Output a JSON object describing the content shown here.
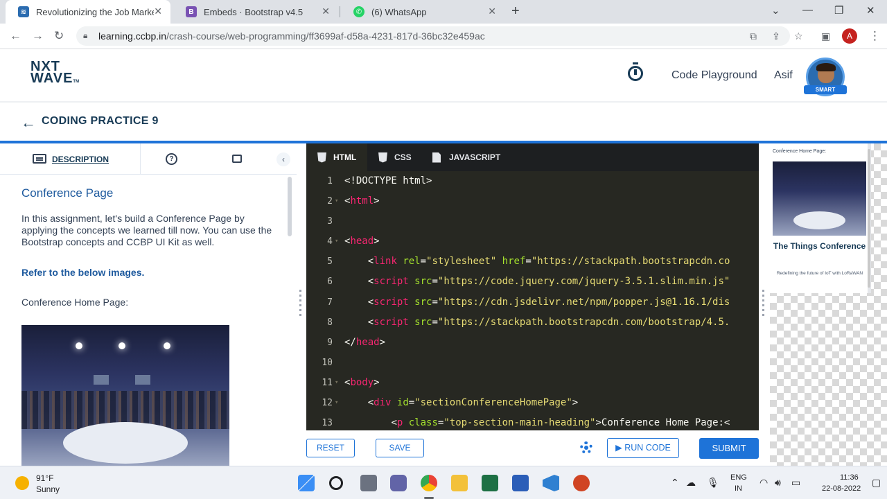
{
  "browser": {
    "tabs": [
      {
        "title": "Revolutionizing the Job Market |",
        "favicon": "nxtwave-icon"
      },
      {
        "title": "Embeds · Bootstrap v4.5",
        "favicon": "bootstrap-icon"
      },
      {
        "title": "(6) WhatsApp",
        "favicon": "whatsapp-icon"
      }
    ],
    "url_domain": "learning.ccbp.in",
    "url_path": "/crash-course/web-programming/ff3699af-d58a-4231-817d-36bc32e459ac",
    "profile_initial": "A"
  },
  "site": {
    "logo_line1": "NXT",
    "logo_line2": "WAVE",
    "logo_tm": "TM",
    "playground_label": "Code Playground",
    "username": "Asif",
    "avatar_badge": "SMART"
  },
  "practice": {
    "title": "CODING PRACTICE 9"
  },
  "description": {
    "tab_label": "DESCRIPTION",
    "help_glyph": "?",
    "collapse_glyph": "‹",
    "heading": "Conference Page",
    "intro": "In this assignment, let's build a Conference Page by applying the concepts we learned till now. You can use the Bootstrap concepts and CCBP UI Kit as well.",
    "refer": "Refer to the below images.",
    "home_label": "Conference Home Page:"
  },
  "editor": {
    "tabs": [
      "HTML",
      "CSS",
      "JAVASCRIPT"
    ],
    "lines": [
      {
        "n": "1",
        "fold": "",
        "html": "<span class='p'>&lt;!DOCTYPE html&gt;</span>"
      },
      {
        "n": "2",
        "fold": "▾",
        "html": "<span class='p'>&lt;</span><span class='t'>html</span><span class='p'>&gt;</span>"
      },
      {
        "n": "3",
        "fold": "",
        "html": ""
      },
      {
        "n": "4",
        "fold": "▾",
        "html": "<span class='p'>&lt;</span><span class='t'>head</span><span class='p'>&gt;</span>"
      },
      {
        "n": "5",
        "fold": "",
        "html": "    <span class='p'>&lt;</span><span class='t'>link</span> <span class='a'>rel</span><span class='p'>=</span><span class='s'>\"stylesheet\"</span> <span class='a'>href</span><span class='p'>=</span><span class='s'>\"https://stackpath.bootstrapcdn.co</span>"
      },
      {
        "n": "6",
        "fold": "",
        "html": "    <span class='p'>&lt;</span><span class='t'>script</span> <span class='a'>src</span><span class='p'>=</span><span class='s'>\"https://code.jquery.com/jquery-3.5.1.slim.min.js\"</span>"
      },
      {
        "n": "7",
        "fold": "",
        "html": "    <span class='p'>&lt;</span><span class='t'>script</span> <span class='a'>src</span><span class='p'>=</span><span class='s'>\"https://cdn.jsdelivr.net/npm/popper.js@1.16.1/dis</span>"
      },
      {
        "n": "8",
        "fold": "",
        "html": "    <span class='p'>&lt;</span><span class='t'>script</span> <span class='a'>src</span><span class='p'>=</span><span class='s'>\"https://stackpath.bootstrapcdn.com/bootstrap/4.5.</span>"
      },
      {
        "n": "9",
        "fold": "",
        "html": "<span class='p'>&lt;/</span><span class='t'>head</span><span class='p'>&gt;</span>"
      },
      {
        "n": "10",
        "fold": "",
        "html": ""
      },
      {
        "n": "11",
        "fold": "▾",
        "html": "<span class='p'>&lt;</span><span class='t'>body</span><span class='p'>&gt;</span>"
      },
      {
        "n": "12",
        "fold": "▾",
        "html": "    <span class='p'>&lt;</span><span class='t'>div</span> <span class='a'>id</span><span class='p'>=</span><span class='s'>\"sectionConferenceHomePage\"</span><span class='p'>&gt;</span>"
      },
      {
        "n": "13",
        "fold": "",
        "html": "        <span class='p'>&lt;</span><span class='t'>p</span> <span class='a'>class</span><span class='p'>=</span><span class='s'>\"top-section-main-heading\"</span><span class='p'>&gt;Conference Home Page:&lt;</span>"
      }
    ],
    "reset_label": "RESET",
    "save_label": "SAVE",
    "run_label": "▶ RUN CODE",
    "submit_label": "SUBMIT"
  },
  "preview": {
    "label": "Conference Home Page:",
    "title": "The Things Conference",
    "subtitle": "Redefining the future of IoT with LoRaWAN"
  },
  "taskbar": {
    "temperature": "91°F",
    "weather": "Sunny",
    "lang1": "ENG",
    "lang2": "IN",
    "time": "11:36",
    "date": "22-08-2022"
  },
  "colors": {
    "brand_blue": "#1e73d8",
    "heading_navy": "#183b56",
    "editor_bg": "#272822"
  }
}
